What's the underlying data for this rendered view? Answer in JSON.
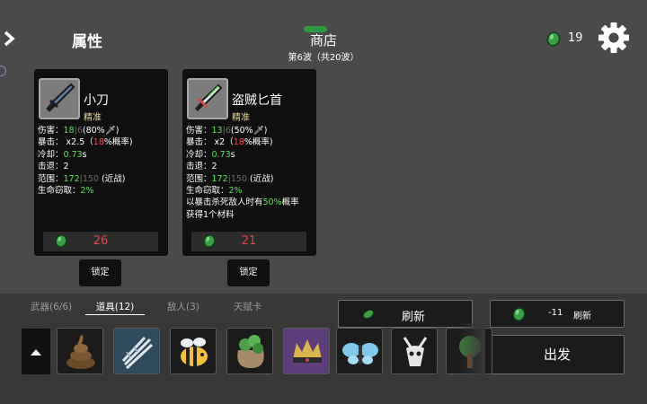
{
  "header": {
    "attributes_label": "属性",
    "shop_title": "商店",
    "wave_text": "第6波（共20波）",
    "money": "19"
  },
  "cards": [
    {
      "name": "小刀",
      "tag": "精准",
      "damage": {
        "label": "伤害：",
        "main": "18",
        "sep": "|",
        "base": "6",
        "scale": "(80%"
      },
      "crit": {
        "label": "暴击：",
        "mult": "x2.5",
        "open": "（",
        "chance": "18",
        "suffix": "%概率)"
      },
      "cooldown": {
        "label": "冷却：",
        "value": "0.73",
        "unit": "s"
      },
      "knockback": {
        "label": "击退：",
        "value": "2"
      },
      "range": {
        "label": "范围：",
        "main": "172",
        "sep": "|",
        "base": "150",
        "kind": "(近战)"
      },
      "lifesteal": {
        "label": "生命窃取：",
        "value": "2%"
      },
      "price": "26"
    },
    {
      "name": "盗贼匕首",
      "tag": "精准",
      "damage": {
        "label": "伤害：",
        "main": "13",
        "sep": "|",
        "base": "6",
        "scale": "(50%"
      },
      "crit": {
        "label": "暴击：",
        "mult": "x2",
        "open": "（",
        "chance": "18",
        "suffix": "%概率)"
      },
      "cooldown": {
        "label": "冷却：",
        "value": "0.73",
        "unit": "s"
      },
      "knockback": {
        "label": "击退：",
        "value": "2"
      },
      "range": {
        "label": "范围：",
        "main": "172",
        "sep": "|",
        "base": "150",
        "kind": "(近战)"
      },
      "lifesteal": {
        "label": "生命窃取：",
        "value": "2%"
      },
      "extra_a": "以暴击杀死敌人时有",
      "extra_pct": "50%",
      "extra_b": "概率",
      "extra_c": "获得1个材料",
      "price": "21"
    }
  ],
  "lock_label": "锁定",
  "tabs": [
    {
      "label": "武器(6/6)"
    },
    {
      "label": "道具(12)"
    },
    {
      "label": "敌人(3)"
    },
    {
      "label": "天赋卡"
    }
  ],
  "refresh": {
    "label": "刷新"
  },
  "refresh_cost": {
    "cost": "-11",
    "label": "刷新"
  },
  "go_label": "出发",
  "items": [
    {
      "icon": "poop-icon"
    },
    {
      "icon": "claw-icon"
    },
    {
      "icon": "bee-icon"
    },
    {
      "icon": "herb-sack-icon"
    },
    {
      "icon": "crown-icon"
    },
    {
      "icon": "butterfly-icon"
    },
    {
      "icon": "skull-icon"
    },
    {
      "icon": "tree-icon"
    }
  ],
  "colors": {
    "background": "#4a4a4a",
    "card": "#0f0f0f",
    "positive": "#5de05d",
    "negative": "#e04545",
    "money": "#3aa047",
    "tag": "#e8d79d"
  }
}
